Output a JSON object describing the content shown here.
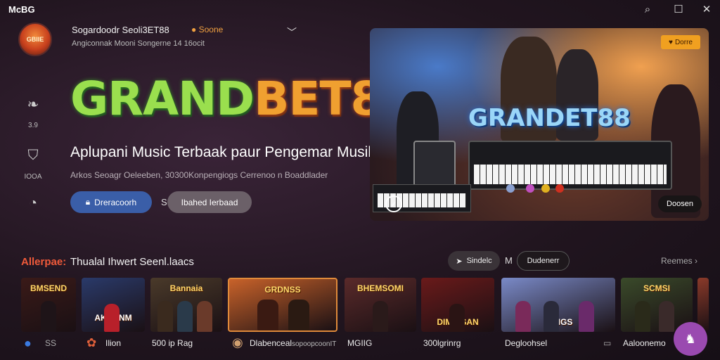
{
  "app": {
    "name": "McBG"
  },
  "window": {
    "minimize": "⌕",
    "maximize": "☐",
    "close": "✕"
  },
  "profile": {
    "avatar_text": "GBIIE",
    "name": "Sogardoodr Seoli3ET88",
    "coins": "Soone",
    "subtitle": "Angiconnak Mooni Songerne 14 16ocit"
  },
  "sidebar": {
    "items": [
      {
        "icon": "headphones-icon",
        "glyph": "❧",
        "label": "3.9"
      },
      {
        "icon": "shield-icon",
        "glyph": "⛉",
        "label": "IOOA"
      },
      {
        "icon": "gauge-icon",
        "glyph": "◔",
        "label": ""
      }
    ]
  },
  "hero_text": {
    "logo_part1": "GRAND",
    "logo_part2": "BET88",
    "headline": "Aplupani Music Terbaak paur Pengemar Musik",
    "description": "Arkos Seoagr Oeleeben, 30300Konpengiogs Cerrenoo n Boaddlader",
    "primary_button": "Dreracoorh",
    "secondary_button": "Ibahed Ierbaad",
    "secondary_prefix": "S"
  },
  "hero_image": {
    "badge": "Dorre",
    "logo": "GRANDET88",
    "tag": "Doosen"
  },
  "section": {
    "label_prefix": "Allerpae:",
    "label_title": "Thualal Ihwert Seenl.laacs",
    "pill1": "Sindelc",
    "pill_sep": "M",
    "pill2": "Dudenerr",
    "see_all": "Reemes"
  },
  "thumbnails": [
    {
      "title": "BMSEND",
      "bg": "#3a1a18"
    },
    {
      "title": "AKANNM",
      "bg": "#2a3a6a"
    },
    {
      "title": "Bannaia",
      "bg": "#4a3a2a"
    },
    {
      "title": "GRDNSS",
      "bg": "#c8622a"
    },
    {
      "title": "BHEMSOMI",
      "bg": "#5a2a2a"
    },
    {
      "title": "DIMIUSAN",
      "bg": "#6a1a1a"
    },
    {
      "title": "VIAIGS",
      "bg": "#7a8ac8"
    },
    {
      "title": "SCMSI",
      "bg": "#3a4a2a"
    },
    {
      "title": "",
      "bg": "#8a3a2a"
    }
  ],
  "captions": [
    {
      "icon": "user-icon",
      "glyph": "●",
      "text": "SS"
    },
    {
      "icon": "puzzle-icon",
      "glyph": "✿",
      "text": "Ilion"
    },
    {
      "icon": "",
      "glyph": "",
      "text": "500 ip Rag"
    },
    {
      "icon": "avatar-icon",
      "glyph": "◉",
      "text": "Dlabenceal",
      "sub": "sopoopcoonIT"
    },
    {
      "icon": "",
      "glyph": "",
      "text": "MGIIG"
    },
    {
      "icon": "",
      "glyph": "",
      "text": "300lgrinrg"
    },
    {
      "icon": "",
      "glyph": "",
      "text": "Degloohsel",
      "extra": "▭"
    },
    {
      "icon": "",
      "glyph": "",
      "text": "Aaloonemo"
    }
  ],
  "fab": {
    "glyph": "♞"
  }
}
